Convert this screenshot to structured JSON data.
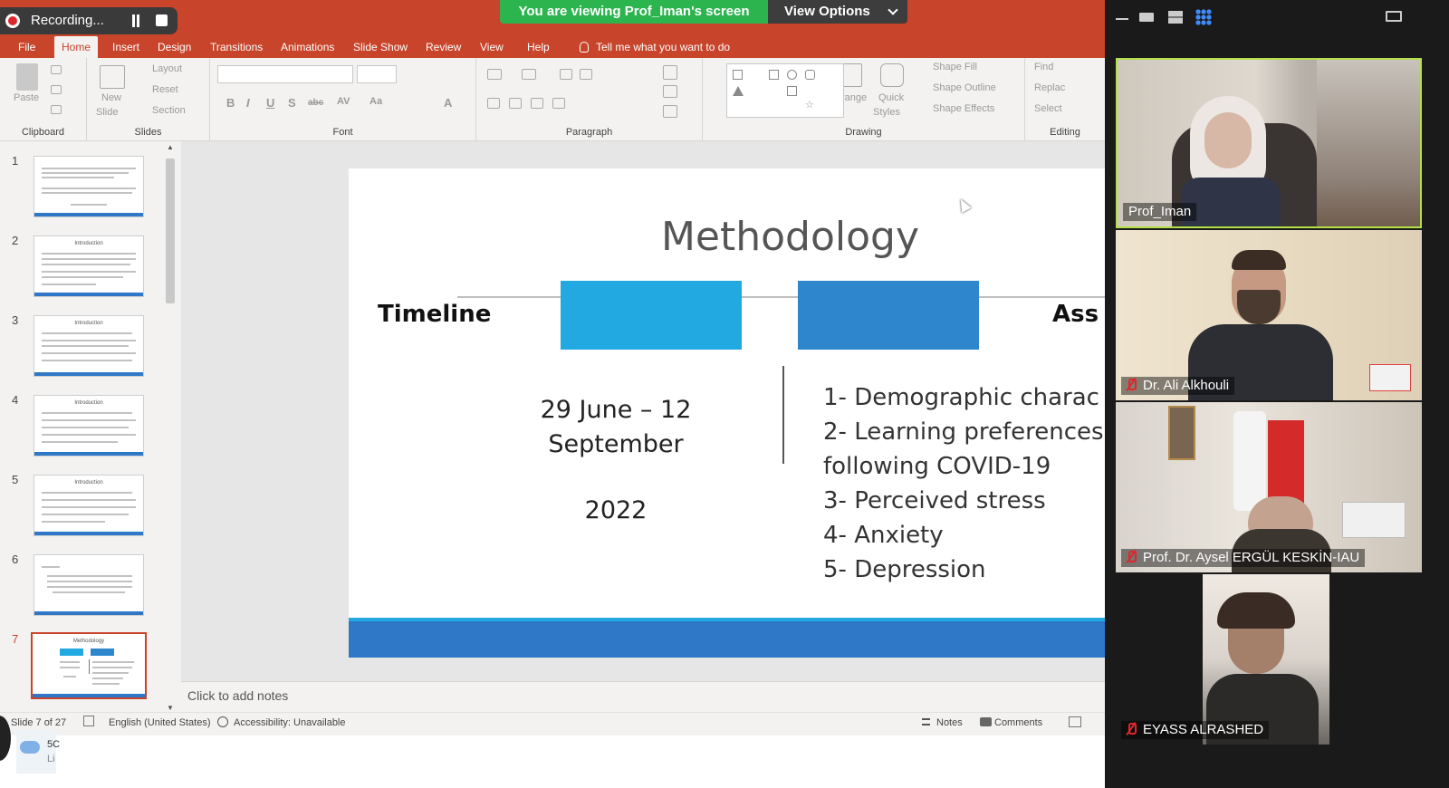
{
  "recording": {
    "label": "Recording..."
  },
  "share_banner": {
    "viewing_text": "You are viewing Prof_Iman's screen",
    "view_options_label": "View Options"
  },
  "ribbon_tabs": [
    "File",
    "Home",
    "Insert",
    "Design",
    "Transitions",
    "Animations",
    "Slide Show",
    "Review",
    "View",
    "Help"
  ],
  "tell_me": "Tell me what you want to do",
  "ribbon": {
    "clipboard": {
      "label": "Clipboard",
      "paste": "Paste"
    },
    "slides": {
      "label": "Slides",
      "new_slide": "New",
      "new_slide2": "Slide",
      "layout": "Layout",
      "reset": "Reset",
      "section": "Section"
    },
    "font": {
      "label": "Font"
    },
    "paragraph": {
      "label": "Paragraph"
    },
    "drawing": {
      "label": "Drawing",
      "arrange": "Arrange",
      "quick_styles": "Quick",
      "quick_styles2": "Styles",
      "shape_fill": "Shape Fill",
      "shape_outline": "Shape Outline",
      "shape_effects": "Shape Effects"
    },
    "editing": {
      "label": "Editing",
      "find": "Find",
      "replace": "Replac",
      "select": "Select"
    }
  },
  "thumbnails": [
    {
      "num": "1",
      "title": ""
    },
    {
      "num": "2",
      "title": "Introduction"
    },
    {
      "num": "3",
      "title": "Introduction"
    },
    {
      "num": "4",
      "title": "Introduction"
    },
    {
      "num": "5",
      "title": "Introduction"
    },
    {
      "num": "6",
      "title": ""
    },
    {
      "num": "7",
      "title": "Methodology"
    }
  ],
  "slide": {
    "title": "Methodology",
    "timeline_label": "Timeline",
    "assessment_label": "Ass",
    "dates_line1": "29 June – 12",
    "dates_line2": "September",
    "year": "2022",
    "items": [
      "1- Demographic charac",
      "2- Learning preferences",
      "following COVID-19",
      "3- Perceived stress",
      "4- Anxiety",
      "5- Depression"
    ]
  },
  "notes_placeholder": "Click to add notes",
  "status": {
    "slide_count": "Slide 7 of 27",
    "language": "English (United States)",
    "accessibility": "Accessibility: Unavailable",
    "notes": "Notes",
    "comments": "Comments"
  },
  "taskbar": {
    "weather_temp": "5C",
    "weather_sub": "Li"
  },
  "participants": [
    {
      "name": "Prof_Iman",
      "muted": false,
      "active": true
    },
    {
      "name": "Dr. Ali Alkhouli",
      "muted": true,
      "active": false
    },
    {
      "name": "Prof. Dr. Aysel ERGÜL KESKİN-IAU",
      "muted": true,
      "active": false
    },
    {
      "name": "EYASS ALRASHED",
      "muted": true,
      "active": false
    }
  ],
  "colors": {
    "ppt_accent": "#c8442a",
    "zoom_green": "#2cb44f",
    "active_speaker": "#b3e04a",
    "mute_red": "#e0262b"
  }
}
